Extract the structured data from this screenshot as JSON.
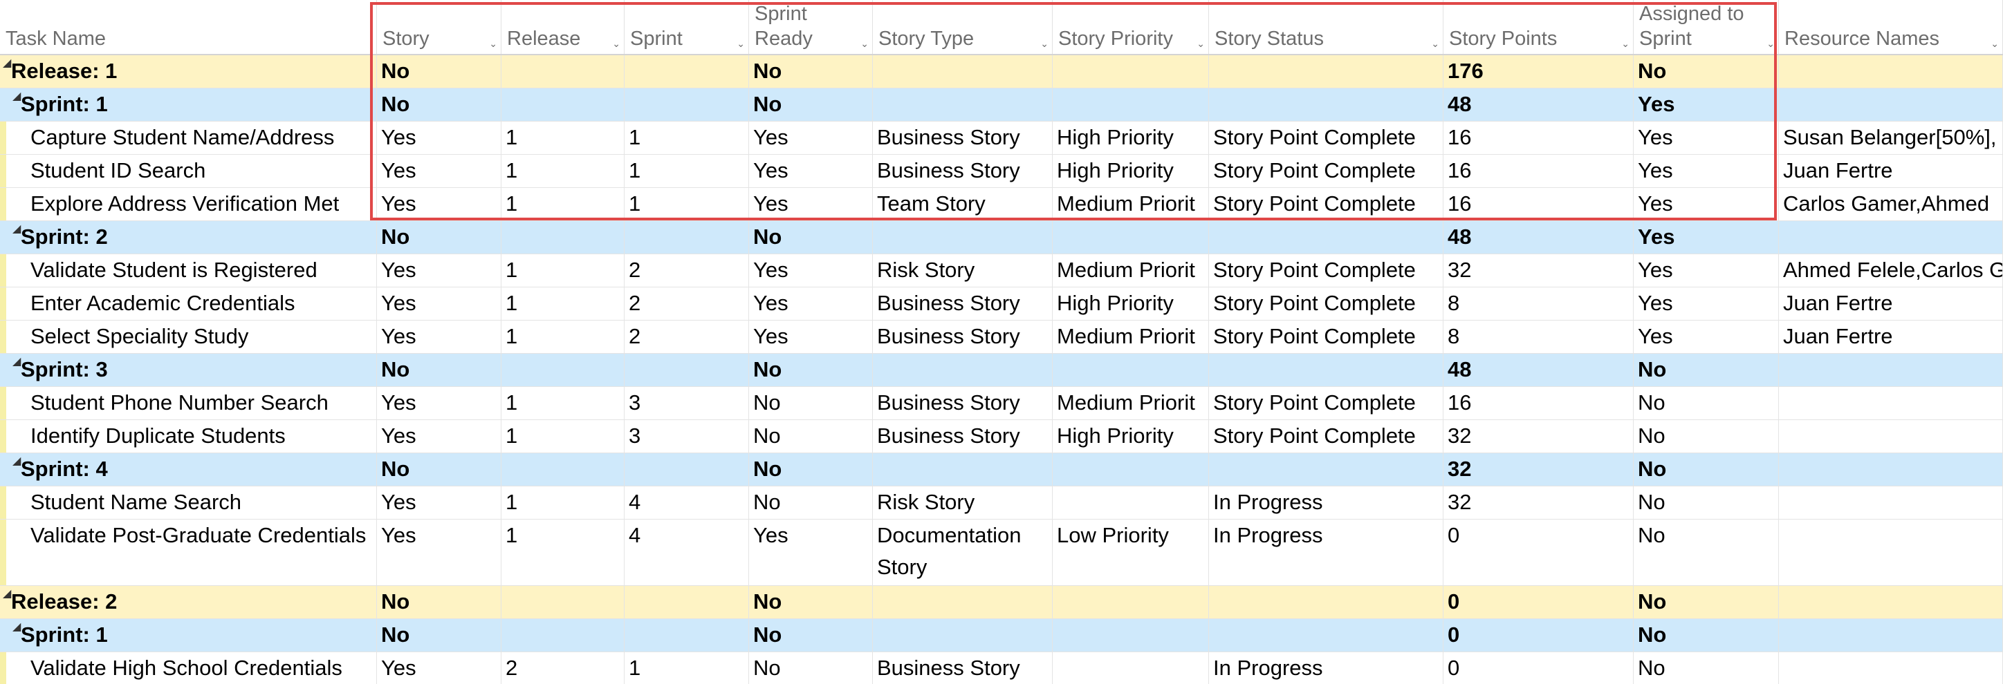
{
  "columns": [
    {
      "key": "task",
      "label": "Task Name"
    },
    {
      "key": "story",
      "label": "Story"
    },
    {
      "key": "release",
      "label": "Release"
    },
    {
      "key": "sprint",
      "label": "Sprint"
    },
    {
      "key": "ready",
      "label": "Sprint\nReady"
    },
    {
      "key": "type",
      "label": "Story Type"
    },
    {
      "key": "priority",
      "label": "Story Priority"
    },
    {
      "key": "status",
      "label": "Story Status"
    },
    {
      "key": "points",
      "label": "Story Points"
    },
    {
      "key": "assigned",
      "label": "Assigned to\nSprint"
    },
    {
      "key": "resources",
      "label": "Resource Names"
    }
  ],
  "rows": [
    {
      "level": "release",
      "task": "Release: 1",
      "story": "No",
      "release": "",
      "sprint": "",
      "ready": "No",
      "type": "",
      "priority": "",
      "status": "",
      "points": "176",
      "assigned": "No",
      "resources": ""
    },
    {
      "level": "sprint",
      "task": "Sprint: 1",
      "story": "No",
      "release": "",
      "sprint": "",
      "ready": "No",
      "type": "",
      "priority": "",
      "status": "",
      "points": "48",
      "assigned": "Yes",
      "resources": ""
    },
    {
      "level": "task",
      "task": "Capture Student Name/Address",
      "story": "Yes",
      "release": "1",
      "sprint": "1",
      "ready": "Yes",
      "type": "Business Story",
      "priority": "High Priority",
      "status": "Story Point Complete",
      "points": "16",
      "assigned": "Yes",
      "resources": "Susan Belanger[50%],"
    },
    {
      "level": "task",
      "task": "Student ID Search",
      "story": "Yes",
      "release": "1",
      "sprint": "1",
      "ready": "Yes",
      "type": "Business Story",
      "priority": "High Priority",
      "status": "Story Point Complete",
      "points": "16",
      "assigned": "Yes",
      "resources": "Juan Fertre"
    },
    {
      "level": "task",
      "task": "Explore Address Verification Met",
      "story": "Yes",
      "release": "1",
      "sprint": "1",
      "ready": "Yes",
      "type": "Team Story",
      "priority": "Medium Priorit",
      "status": "Story Point Complete",
      "points": "16",
      "assigned": "Yes",
      "resources": "Carlos Gamer,Ahmed"
    },
    {
      "level": "sprint",
      "task": "Sprint: 2",
      "story": "No",
      "release": "",
      "sprint": "",
      "ready": "No",
      "type": "",
      "priority": "",
      "status": "",
      "points": "48",
      "assigned": "Yes",
      "resources": ""
    },
    {
      "level": "task",
      "task": "Validate Student is Registered",
      "story": "Yes",
      "release": "1",
      "sprint": "2",
      "ready": "Yes",
      "type": "Risk Story",
      "priority": "Medium Priorit",
      "status": "Story Point Complete",
      "points": "32",
      "assigned": "Yes",
      "resources": "Ahmed Felele,Carlos G"
    },
    {
      "level": "task",
      "task": "Enter Academic Credentials",
      "story": "Yes",
      "release": "1",
      "sprint": "2",
      "ready": "Yes",
      "type": "Business Story",
      "priority": "High Priority",
      "status": "Story Point Complete",
      "points": "8",
      "assigned": "Yes",
      "resources": "Juan Fertre"
    },
    {
      "level": "task",
      "task": "Select Speciality Study",
      "story": "Yes",
      "release": "1",
      "sprint": "2",
      "ready": "Yes",
      "type": "Business Story",
      "priority": "Medium Priorit",
      "status": "Story Point Complete",
      "points": "8",
      "assigned": "Yes",
      "resources": "Juan Fertre"
    },
    {
      "level": "sprint",
      "task": "Sprint: 3",
      "story": "No",
      "release": "",
      "sprint": "",
      "ready": "No",
      "type": "",
      "priority": "",
      "status": "",
      "points": "48",
      "assigned": "No",
      "resources": ""
    },
    {
      "level": "task",
      "task": "Student Phone Number Search",
      "story": "Yes",
      "release": "1",
      "sprint": "3",
      "ready": "No",
      "type": "Business Story",
      "priority": "Medium Priorit",
      "status": "Story Point Complete",
      "points": "16",
      "assigned": "No",
      "resources": ""
    },
    {
      "level": "task",
      "task": "Identify Duplicate Students",
      "story": "Yes",
      "release": "1",
      "sprint": "3",
      "ready": "No",
      "type": "Business Story",
      "priority": "High Priority",
      "status": "Story Point Complete",
      "points": "32",
      "assigned": "No",
      "resources": ""
    },
    {
      "level": "sprint",
      "task": "Sprint: 4",
      "story": "No",
      "release": "",
      "sprint": "",
      "ready": "No",
      "type": "",
      "priority": "",
      "status": "",
      "points": "32",
      "assigned": "No",
      "resources": ""
    },
    {
      "level": "task",
      "task": "Student Name Search",
      "story": "Yes",
      "release": "1",
      "sprint": "4",
      "ready": "No",
      "type": "Risk Story",
      "priority": "",
      "status": "In Progress",
      "points": "32",
      "assigned": "No",
      "resources": ""
    },
    {
      "level": "task",
      "task": "Validate Post-Graduate Credentials",
      "story": "Yes",
      "release": "1",
      "sprint": "4",
      "ready": "Yes",
      "type": "Documentation Story",
      "priority": "Low Priority",
      "status": "In Progress",
      "points": "0",
      "assigned": "No",
      "resources": "",
      "tall": true
    },
    {
      "level": "release",
      "task": "Release: 2",
      "story": "No",
      "release": "",
      "sprint": "",
      "ready": "No",
      "type": "",
      "priority": "",
      "status": "",
      "points": "0",
      "assigned": "No",
      "resources": ""
    },
    {
      "level": "sprint",
      "task": "Sprint: 1",
      "story": "No",
      "release": "",
      "sprint": "",
      "ready": "No",
      "type": "",
      "priority": "",
      "status": "",
      "points": "0",
      "assigned": "No",
      "resources": ""
    },
    {
      "level": "task",
      "task": "Validate High School Credentials",
      "story": "Yes",
      "release": "2",
      "sprint": "1",
      "ready": "No",
      "type": "Business Story",
      "priority": "",
      "status": "In Progress",
      "points": "0",
      "assigned": "No",
      "resources": ""
    }
  ]
}
